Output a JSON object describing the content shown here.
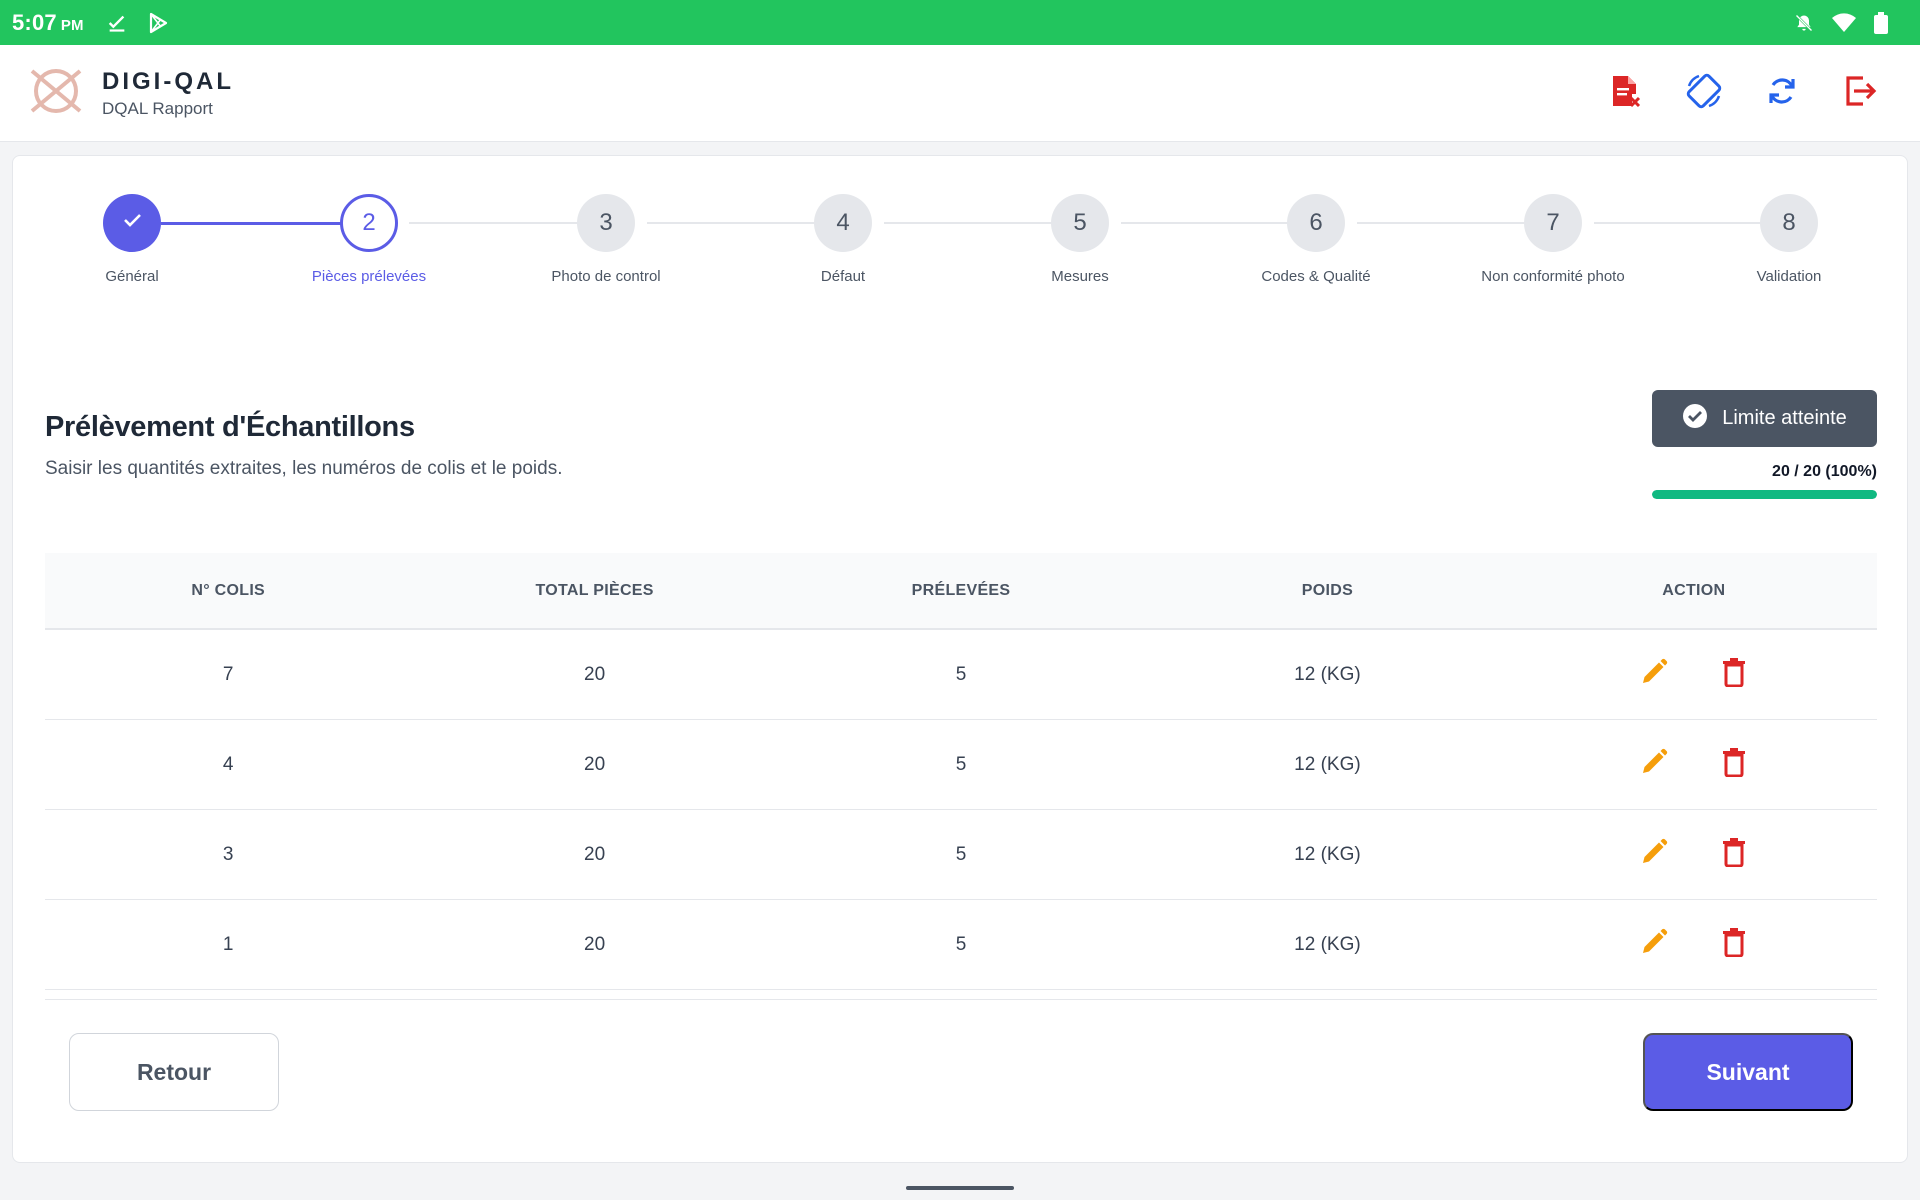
{
  "status_bar": {
    "time": "5:07",
    "ampm": "PM",
    "left_icons": [
      "download-done-icon",
      "play-store-icon"
    ],
    "right_icons": [
      "notifications-off-icon",
      "wifi-icon",
      "battery-icon"
    ]
  },
  "header": {
    "brand_name": "DIGI-QAL",
    "brand_sub": "DQAL Rapport",
    "actions": [
      {
        "name": "cancel-report-icon",
        "color": "#dc2626"
      },
      {
        "name": "screen-rotation-icon",
        "color": "#2563eb"
      },
      {
        "name": "sync-icon",
        "color": "#2563eb"
      },
      {
        "name": "logout-icon",
        "color": "#dc2626"
      }
    ]
  },
  "stepper": {
    "current": 2,
    "steps": [
      {
        "number": "1",
        "label": "Général",
        "state": "done"
      },
      {
        "number": "2",
        "label": "Pièces prélevées",
        "state": "active"
      },
      {
        "number": "3",
        "label": "Photo de control",
        "state": "pending"
      },
      {
        "number": "4",
        "label": "Défaut",
        "state": "pending"
      },
      {
        "number": "5",
        "label": "Mesures",
        "state": "pending"
      },
      {
        "number": "6",
        "label": "Codes & Qualité",
        "state": "pending"
      },
      {
        "number": "7",
        "label": "Non conformité photo",
        "state": "pending"
      },
      {
        "number": "8",
        "label": "Validation",
        "state": "pending"
      }
    ]
  },
  "section": {
    "title": "Prélèvement d'Échantillons",
    "description": "Saisir les quantités extraites, les numéros de colis et le poids."
  },
  "limit": {
    "badge_label": "Limite atteinte",
    "progress_text": "20 / 20 (100%)",
    "progress_fraction": 1.0,
    "color": "#10b981"
  },
  "table": {
    "headers": [
      "N° COLIS",
      "TOTAL PIÈCES",
      "PRÉLEVÉES",
      "POIDS",
      "ACTION"
    ],
    "rows": [
      {
        "colis": "7",
        "total": "20",
        "prelevees": "5",
        "poids": "12 (KG)"
      },
      {
        "colis": "4",
        "total": "20",
        "prelevees": "5",
        "poids": "12 (KG)"
      },
      {
        "colis": "3",
        "total": "20",
        "prelevees": "5",
        "poids": "12 (KG)"
      },
      {
        "colis": "1",
        "total": "20",
        "prelevees": "5",
        "poids": "12 (KG)"
      }
    ],
    "edit_icon_color": "#f59e0b",
    "delete_icon_color": "#dc2626"
  },
  "footer": {
    "back_label": "Retour",
    "next_label": "Suivant"
  },
  "colors": {
    "status_bar": "#22c55e",
    "primary": "#5b5ce6"
  }
}
